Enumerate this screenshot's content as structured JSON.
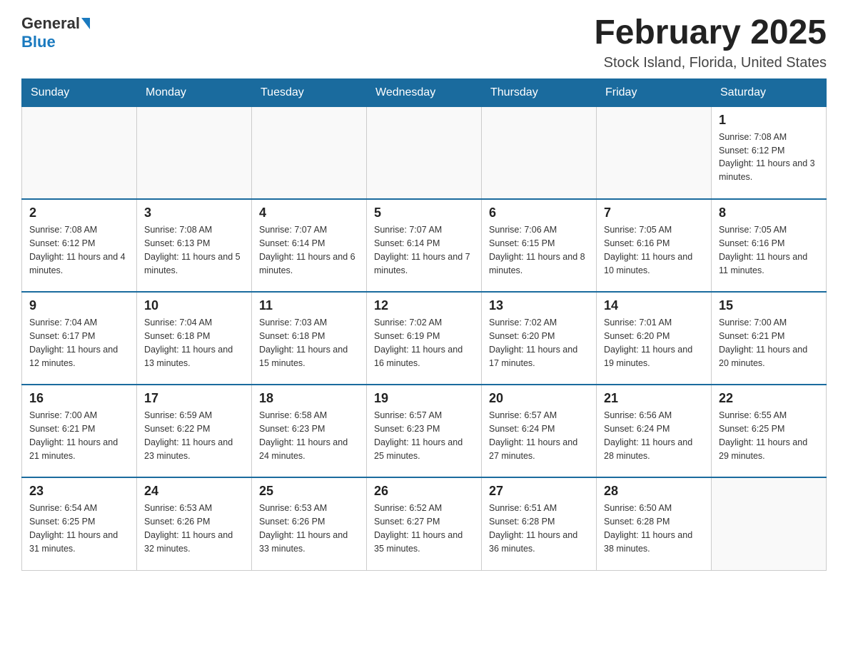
{
  "header": {
    "logo_general": "General",
    "logo_blue": "Blue",
    "month_year": "February 2025",
    "location": "Stock Island, Florida, United States"
  },
  "days_of_week": [
    "Sunday",
    "Monday",
    "Tuesday",
    "Wednesday",
    "Thursday",
    "Friday",
    "Saturday"
  ],
  "weeks": [
    {
      "days": [
        {
          "number": "",
          "empty": true
        },
        {
          "number": "",
          "empty": true
        },
        {
          "number": "",
          "empty": true
        },
        {
          "number": "",
          "empty": true
        },
        {
          "number": "",
          "empty": true
        },
        {
          "number": "",
          "empty": true
        },
        {
          "number": "1",
          "sunrise": "Sunrise: 7:08 AM",
          "sunset": "Sunset: 6:12 PM",
          "daylight": "Daylight: 11 hours and 3 minutes."
        }
      ]
    },
    {
      "days": [
        {
          "number": "2",
          "sunrise": "Sunrise: 7:08 AM",
          "sunset": "Sunset: 6:12 PM",
          "daylight": "Daylight: 11 hours and 4 minutes."
        },
        {
          "number": "3",
          "sunrise": "Sunrise: 7:08 AM",
          "sunset": "Sunset: 6:13 PM",
          "daylight": "Daylight: 11 hours and 5 minutes."
        },
        {
          "number": "4",
          "sunrise": "Sunrise: 7:07 AM",
          "sunset": "Sunset: 6:14 PM",
          "daylight": "Daylight: 11 hours and 6 minutes."
        },
        {
          "number": "5",
          "sunrise": "Sunrise: 7:07 AM",
          "sunset": "Sunset: 6:14 PM",
          "daylight": "Daylight: 11 hours and 7 minutes."
        },
        {
          "number": "6",
          "sunrise": "Sunrise: 7:06 AM",
          "sunset": "Sunset: 6:15 PM",
          "daylight": "Daylight: 11 hours and 8 minutes."
        },
        {
          "number": "7",
          "sunrise": "Sunrise: 7:05 AM",
          "sunset": "Sunset: 6:16 PM",
          "daylight": "Daylight: 11 hours and 10 minutes."
        },
        {
          "number": "8",
          "sunrise": "Sunrise: 7:05 AM",
          "sunset": "Sunset: 6:16 PM",
          "daylight": "Daylight: 11 hours and 11 minutes."
        }
      ]
    },
    {
      "days": [
        {
          "number": "9",
          "sunrise": "Sunrise: 7:04 AM",
          "sunset": "Sunset: 6:17 PM",
          "daylight": "Daylight: 11 hours and 12 minutes."
        },
        {
          "number": "10",
          "sunrise": "Sunrise: 7:04 AM",
          "sunset": "Sunset: 6:18 PM",
          "daylight": "Daylight: 11 hours and 13 minutes."
        },
        {
          "number": "11",
          "sunrise": "Sunrise: 7:03 AM",
          "sunset": "Sunset: 6:18 PM",
          "daylight": "Daylight: 11 hours and 15 minutes."
        },
        {
          "number": "12",
          "sunrise": "Sunrise: 7:02 AM",
          "sunset": "Sunset: 6:19 PM",
          "daylight": "Daylight: 11 hours and 16 minutes."
        },
        {
          "number": "13",
          "sunrise": "Sunrise: 7:02 AM",
          "sunset": "Sunset: 6:20 PM",
          "daylight": "Daylight: 11 hours and 17 minutes."
        },
        {
          "number": "14",
          "sunrise": "Sunrise: 7:01 AM",
          "sunset": "Sunset: 6:20 PM",
          "daylight": "Daylight: 11 hours and 19 minutes."
        },
        {
          "number": "15",
          "sunrise": "Sunrise: 7:00 AM",
          "sunset": "Sunset: 6:21 PM",
          "daylight": "Daylight: 11 hours and 20 minutes."
        }
      ]
    },
    {
      "days": [
        {
          "number": "16",
          "sunrise": "Sunrise: 7:00 AM",
          "sunset": "Sunset: 6:21 PM",
          "daylight": "Daylight: 11 hours and 21 minutes."
        },
        {
          "number": "17",
          "sunrise": "Sunrise: 6:59 AM",
          "sunset": "Sunset: 6:22 PM",
          "daylight": "Daylight: 11 hours and 23 minutes."
        },
        {
          "number": "18",
          "sunrise": "Sunrise: 6:58 AM",
          "sunset": "Sunset: 6:23 PM",
          "daylight": "Daylight: 11 hours and 24 minutes."
        },
        {
          "number": "19",
          "sunrise": "Sunrise: 6:57 AM",
          "sunset": "Sunset: 6:23 PM",
          "daylight": "Daylight: 11 hours and 25 minutes."
        },
        {
          "number": "20",
          "sunrise": "Sunrise: 6:57 AM",
          "sunset": "Sunset: 6:24 PM",
          "daylight": "Daylight: 11 hours and 27 minutes."
        },
        {
          "number": "21",
          "sunrise": "Sunrise: 6:56 AM",
          "sunset": "Sunset: 6:24 PM",
          "daylight": "Daylight: 11 hours and 28 minutes."
        },
        {
          "number": "22",
          "sunrise": "Sunrise: 6:55 AM",
          "sunset": "Sunset: 6:25 PM",
          "daylight": "Daylight: 11 hours and 29 minutes."
        }
      ]
    },
    {
      "days": [
        {
          "number": "23",
          "sunrise": "Sunrise: 6:54 AM",
          "sunset": "Sunset: 6:25 PM",
          "daylight": "Daylight: 11 hours and 31 minutes."
        },
        {
          "number": "24",
          "sunrise": "Sunrise: 6:53 AM",
          "sunset": "Sunset: 6:26 PM",
          "daylight": "Daylight: 11 hours and 32 minutes."
        },
        {
          "number": "25",
          "sunrise": "Sunrise: 6:53 AM",
          "sunset": "Sunset: 6:26 PM",
          "daylight": "Daylight: 11 hours and 33 minutes."
        },
        {
          "number": "26",
          "sunrise": "Sunrise: 6:52 AM",
          "sunset": "Sunset: 6:27 PM",
          "daylight": "Daylight: 11 hours and 35 minutes."
        },
        {
          "number": "27",
          "sunrise": "Sunrise: 6:51 AM",
          "sunset": "Sunset: 6:28 PM",
          "daylight": "Daylight: 11 hours and 36 minutes."
        },
        {
          "number": "28",
          "sunrise": "Sunrise: 6:50 AM",
          "sunset": "Sunset: 6:28 PM",
          "daylight": "Daylight: 11 hours and 38 minutes."
        },
        {
          "number": "",
          "empty": true
        }
      ]
    }
  ]
}
